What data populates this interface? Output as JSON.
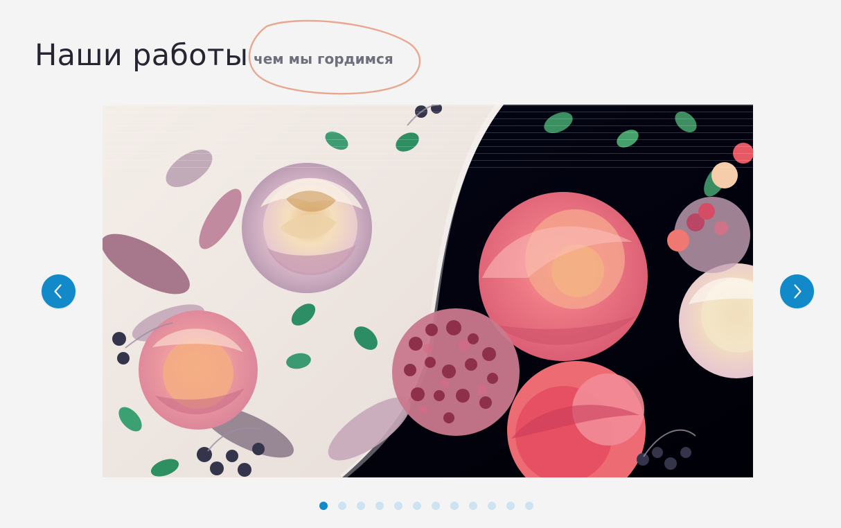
{
  "section": {
    "title": "Наши работы",
    "subtitle": "чем мы гордимся"
  },
  "carousel": {
    "slide_count": 12,
    "active_slide": 1,
    "prev_icon": "chevron-left-icon",
    "next_icon": "chevron-right-icon"
  },
  "colors": {
    "accent": "#1289c8",
    "subtitle_oval": "#e8a88f",
    "title": "#262633"
  }
}
